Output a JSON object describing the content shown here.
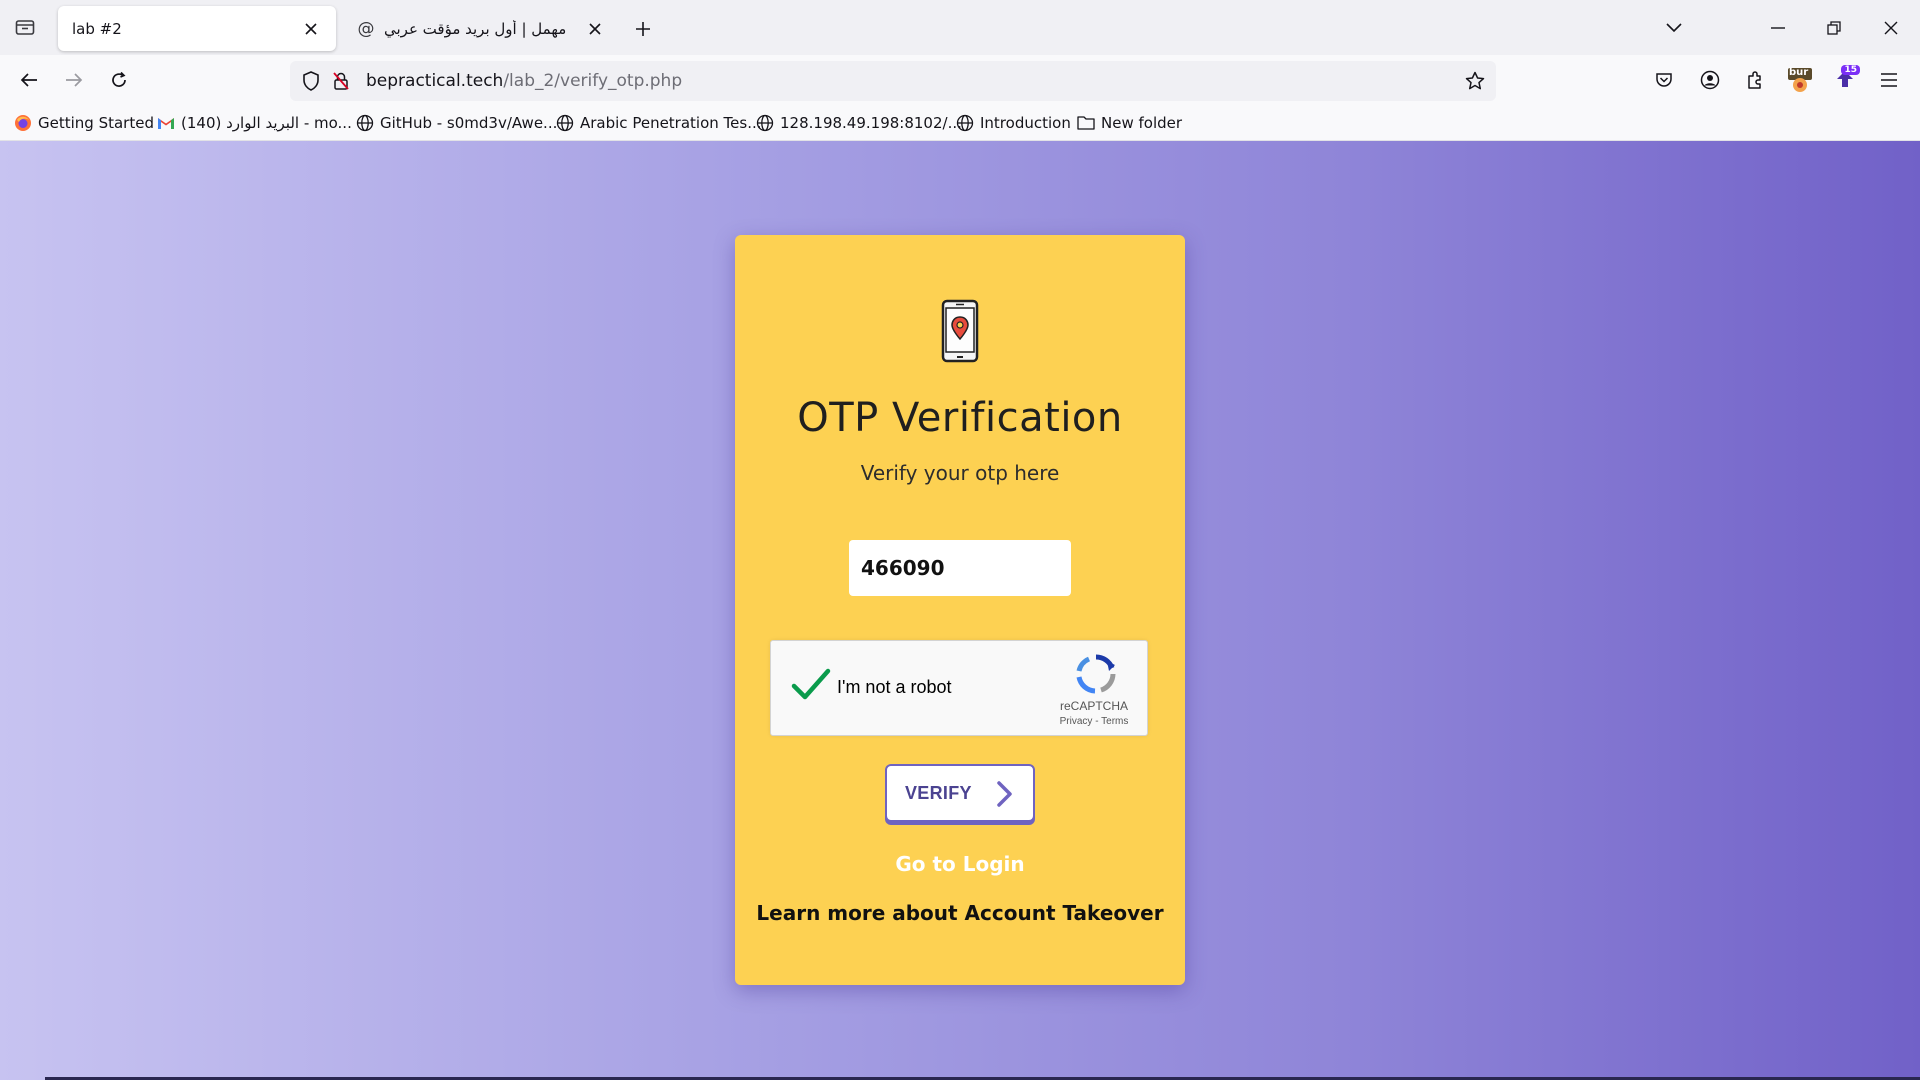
{
  "browser": {
    "tabs": [
      {
        "label": "lab #2",
        "active": true
      },
      {
        "label": "مهمل | أول بريد مؤقت عربي",
        "active": false,
        "icon": "at-icon"
      }
    ],
    "url": {
      "domain": "bepractical.tech",
      "path": "/lab_2/verify_otp.php"
    },
    "extension_badge": "15",
    "burp_label": "bur",
    "bookmarks": [
      {
        "label": "Getting Started",
        "icon": "firefox-icon"
      },
      {
        "label": "البريد الوارد (140) - mo...",
        "icon": "gmail-icon"
      },
      {
        "label": "GitHub - s0md3v/Awe...",
        "icon": "globe-icon"
      },
      {
        "label": "Arabic Penetration Tes...",
        "icon": "globe-icon"
      },
      {
        "label": "128.198.49.198:8102/...",
        "icon": "globe-icon"
      },
      {
        "label": "Introduction",
        "icon": "globe-icon"
      },
      {
        "label": "New folder",
        "icon": "folder-icon"
      }
    ]
  },
  "page": {
    "title": "OTP Verification",
    "subtitle": "Verify your otp here",
    "otp_value": "466090",
    "recaptcha": {
      "label": "I'm not a robot",
      "brand": "reCAPTCHA",
      "links": "Privacy - Terms",
      "checked": true
    },
    "verify_label": "VERIFY",
    "login_link": "Go to Login",
    "learn_link": "Learn more about Account Takeover"
  },
  "colors": {
    "card": "#fdd152",
    "gradient_start": "#c7c3f1",
    "gradient_end": "#7161c8",
    "button_accent": "#6f63c0"
  }
}
